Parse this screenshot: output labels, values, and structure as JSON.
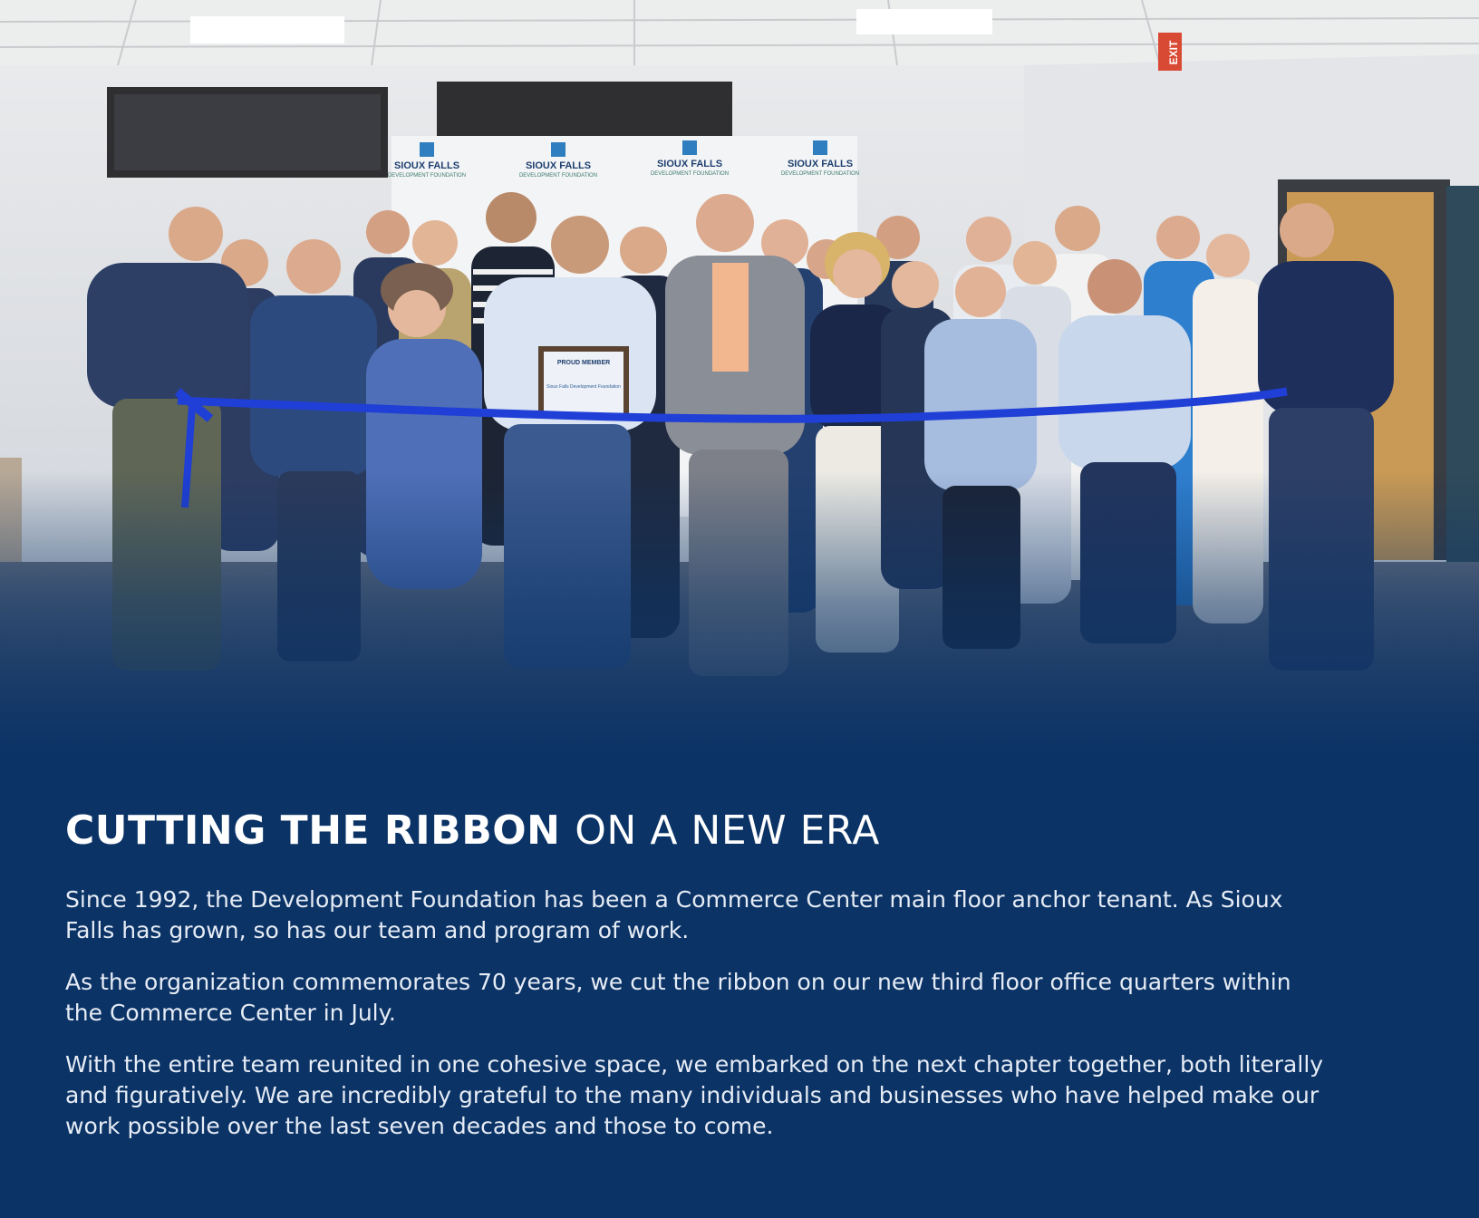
{
  "photo": {
    "backdrop_logo_text": "SIOUX FALLS",
    "backdrop_logo_subtext": "DEVELOPMENT FOUNDATION",
    "exit_sign": "EXIT",
    "certificate_title": "PROUD MEMBER",
    "certificate_body": "Sioux Falls Development Foundation",
    "ribbon_color": "#1f3fd6"
  },
  "heading": {
    "bold": "CUTTING THE RIBBON",
    "light": "ON A NEW ERA"
  },
  "paragraphs": [
    "Since 1992, the Development Foundation has been a Commerce Center main floor anchor tenant. As Sioux Falls has grown, so has our team and program of work.",
    "As the organization commemorates 70 years, we cut the ribbon on our new third floor office quarters within the Commerce Center in July.",
    "With the entire team reunited in one cohesive space, we embarked on the next chapter together, both literally and figuratively. We are incredibly grateful to the many individuals and businesses who have helped make our work possible over the last seven decades and those to come."
  ],
  "colors": {
    "background": "#0b3366",
    "heading": "#ffffff",
    "body_text": "#e6ecf5"
  }
}
